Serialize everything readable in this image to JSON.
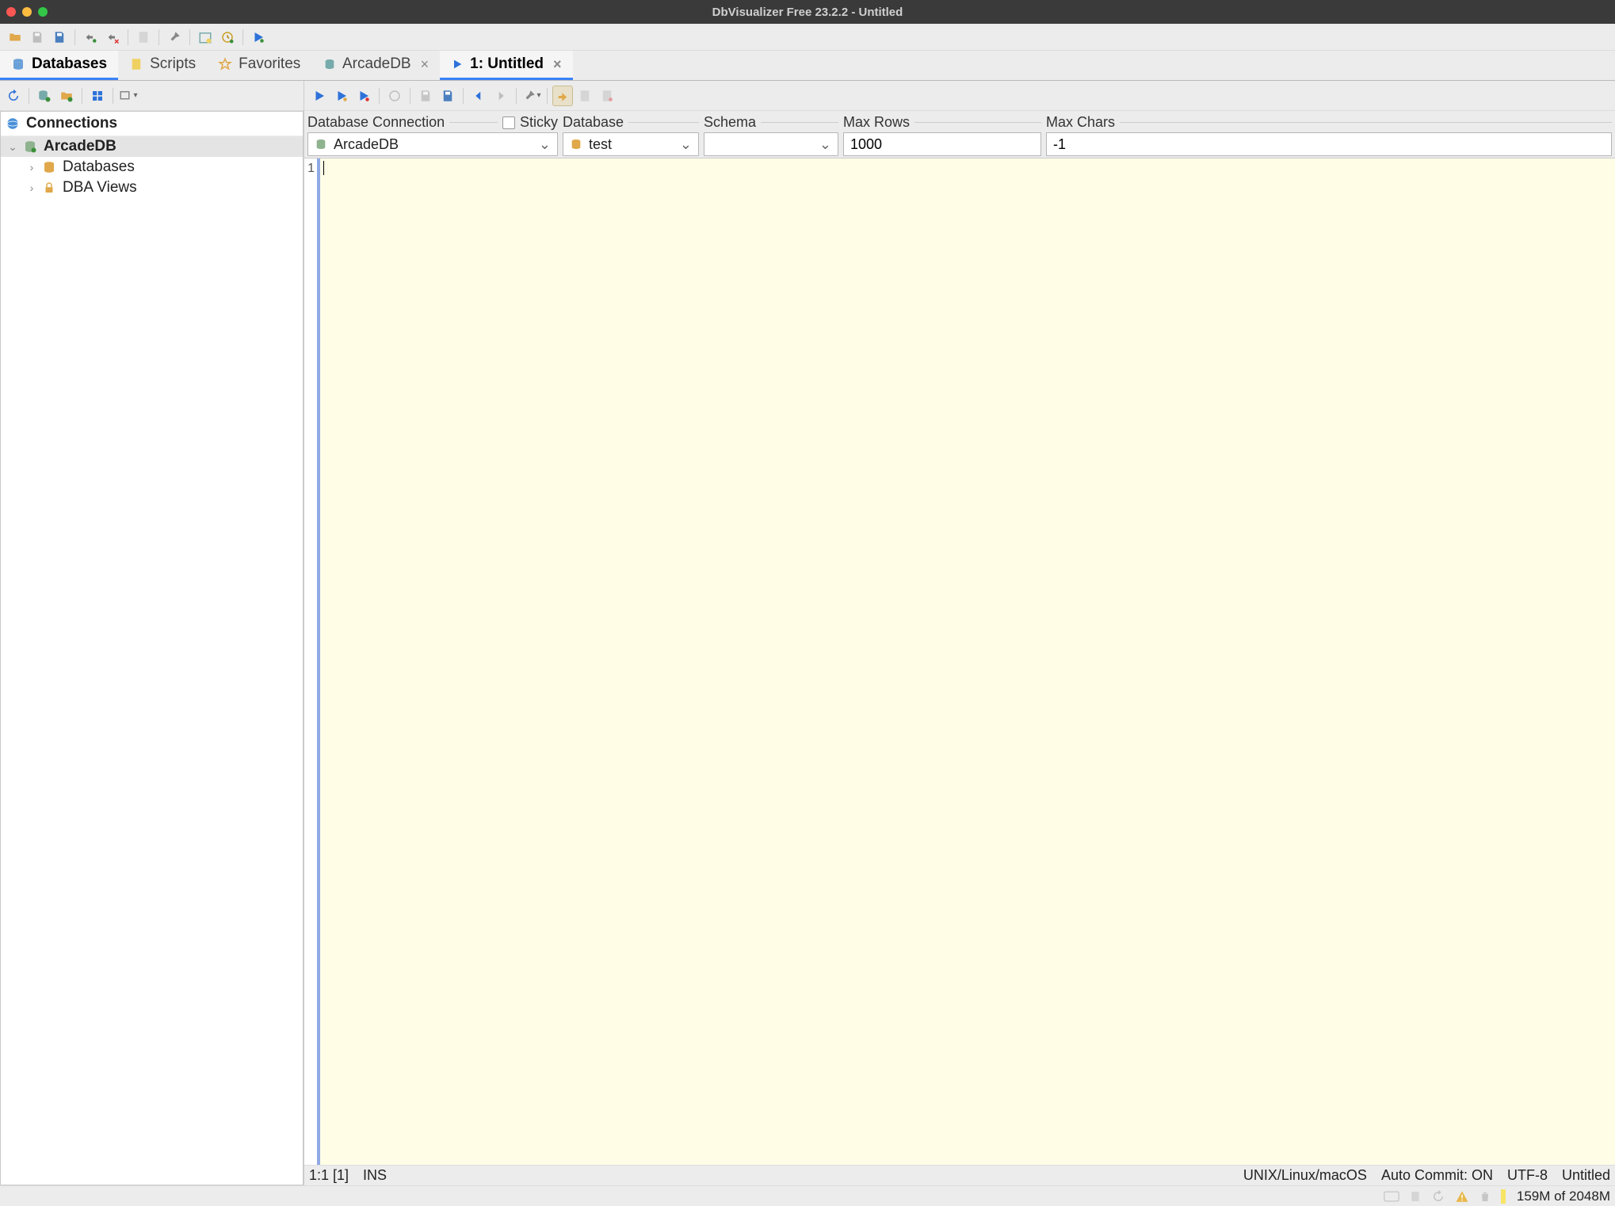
{
  "window": {
    "title": "DbVisualizer Free 23.2.2 - Untitled"
  },
  "navTabs": {
    "databases": "Databases",
    "scripts": "Scripts",
    "favorites": "Favorites"
  },
  "editorTabs": {
    "arcadedb": "ArcadeDB",
    "untitled": "1: Untitled"
  },
  "tree": {
    "header": "Connections",
    "items": {
      "arcadedb": "ArcadeDB",
      "databases": "Databases",
      "dbaViews": "DBA Views"
    }
  },
  "connectionRow": {
    "dbConnLabel": "Database Connection",
    "stickyLabel": "Sticky",
    "databaseLabel": "Database",
    "schemaLabel": "Schema",
    "maxRowsLabel": "Max Rows",
    "maxCharsLabel": "Max Chars",
    "dbConnValue": "ArcadeDB",
    "databaseValue": "test",
    "schemaValue": "",
    "maxRowsValue": "1000",
    "maxCharsValue": "-1"
  },
  "editor": {
    "lineNumber": "1"
  },
  "status": {
    "pos": "1:1 [1]",
    "mode": "INS",
    "os": "UNIX/Linux/macOS",
    "autocommit": "Auto Commit: ON",
    "encoding": "UTF-8",
    "docname": "Untitled",
    "memory": "159M of 2048M"
  }
}
